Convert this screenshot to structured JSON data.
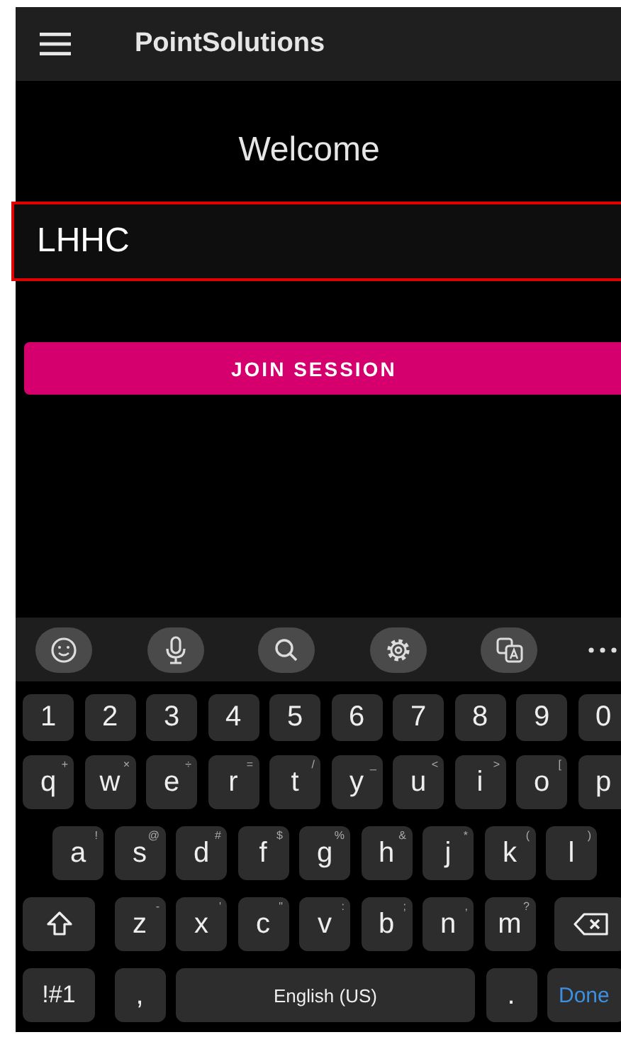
{
  "app_bar": {
    "title": "PointSolutions"
  },
  "welcome": "Welcome",
  "session_field": {
    "value": "LHHC",
    "error": true
  },
  "join_button": {
    "label": "JOIN SESSION"
  },
  "keyboard": {
    "toolbar": [
      {
        "kind": "emoji"
      },
      {
        "kind": "voice"
      },
      {
        "kind": "search"
      },
      {
        "kind": "settings"
      },
      {
        "kind": "translate"
      },
      {
        "kind": "more"
      }
    ],
    "key_rows": [
      [
        {
          "kind": "char",
          "label": "1"
        },
        {
          "kind": "char",
          "label": "2"
        },
        {
          "kind": "char",
          "label": "3"
        },
        {
          "kind": "char",
          "label": "4"
        },
        {
          "kind": "char",
          "label": "5"
        },
        {
          "kind": "char",
          "label": "6"
        },
        {
          "kind": "char",
          "label": "7"
        },
        {
          "kind": "char",
          "label": "8"
        },
        {
          "kind": "char",
          "label": "9"
        },
        {
          "kind": "char",
          "label": "0"
        }
      ],
      [
        {
          "kind": "char",
          "label": "q",
          "hint": "+"
        },
        {
          "kind": "char",
          "label": "w",
          "hint": "×"
        },
        {
          "kind": "char",
          "label": "e",
          "hint": "÷"
        },
        {
          "kind": "char",
          "label": "r",
          "hint": "="
        },
        {
          "kind": "char",
          "label": "t",
          "hint": "/"
        },
        {
          "kind": "char",
          "label": "y",
          "hint": "_"
        },
        {
          "kind": "char",
          "label": "u",
          "hint": "<"
        },
        {
          "kind": "char",
          "label": "i",
          "hint": ">"
        },
        {
          "kind": "char",
          "label": "o",
          "hint": "["
        },
        {
          "kind": "char",
          "label": "p"
        }
      ],
      [
        {
          "kind": "char",
          "label": "a",
          "hint": "!"
        },
        {
          "kind": "char",
          "label": "s",
          "hint": "@"
        },
        {
          "kind": "char",
          "label": "d",
          "hint": "#"
        },
        {
          "kind": "char",
          "label": "f",
          "hint": "$"
        },
        {
          "kind": "char",
          "label": "g",
          "hint": "%"
        },
        {
          "kind": "char",
          "label": "h",
          "hint": "&"
        },
        {
          "kind": "char",
          "label": "j",
          "hint": "*"
        },
        {
          "kind": "char",
          "label": "k",
          "hint": "("
        },
        {
          "kind": "char",
          "label": "l",
          "hint": ")"
        }
      ],
      [
        {
          "kind": "shift"
        },
        {
          "kind": "char",
          "label": "z",
          "hint": "-"
        },
        {
          "kind": "char",
          "label": "x",
          "hint": "'"
        },
        {
          "kind": "char",
          "label": "c",
          "hint": "\""
        },
        {
          "kind": "char",
          "label": "v",
          "hint": ":"
        },
        {
          "kind": "char",
          "label": "b",
          "hint": ";"
        },
        {
          "kind": "char",
          "label": "n",
          "hint": ","
        },
        {
          "kind": "char",
          "label": "m",
          "hint": "?"
        },
        {
          "kind": "backspace"
        }
      ]
    ],
    "bottom_bar": {
      "symbols_key": "!#1",
      "comma_key": ",",
      "space_bar": "English (US)",
      "period_key": ".",
      "done_key": "Done"
    }
  }
}
